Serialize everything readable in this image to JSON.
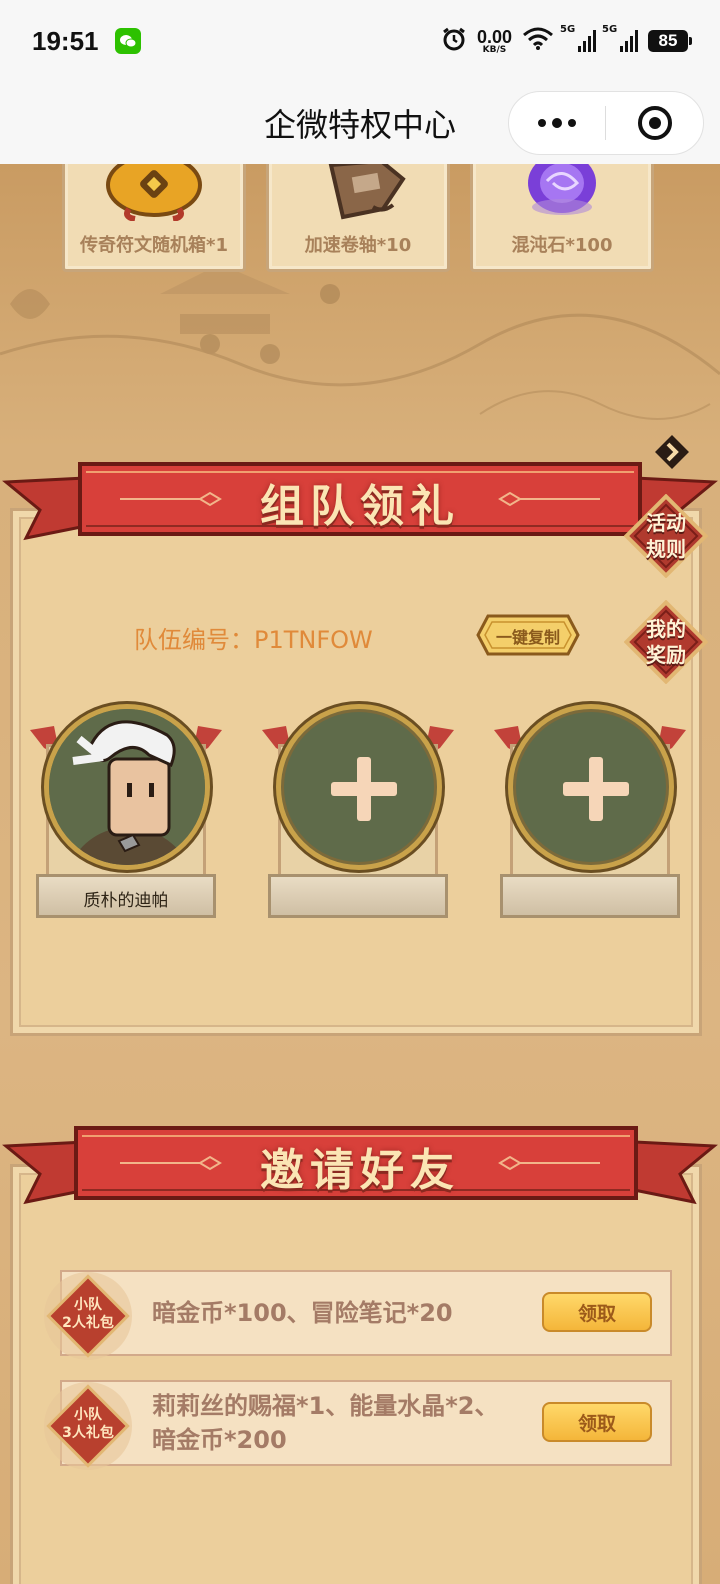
{
  "status_bar": {
    "time": "19:51",
    "net_speed_value": "0.00",
    "net_speed_unit": "KB/S",
    "signal1_label": "5G",
    "signal2_label": "5G",
    "battery": "85"
  },
  "nav": {
    "title": "企微特权中心"
  },
  "top_rewards": [
    {
      "label": "传奇符文随机箱*1",
      "icon": "gold-bag-icon"
    },
    {
      "label": "加速卷轴*10",
      "icon": "scroll-icon"
    },
    {
      "label": "混沌石*100",
      "icon": "purple-orb-icon"
    }
  ],
  "team_section": {
    "title": "组队领礼",
    "rules_label": "活动\n规则",
    "my_rewards_label": "我的\n奖励",
    "team_id_text": "队伍编号：P1TNFOW",
    "copy_label": "一键复制",
    "members": [
      {
        "name": "质朴的迪帕",
        "filled": true
      },
      {
        "name": "",
        "filled": false
      },
      {
        "name": "",
        "filled": false
      }
    ]
  },
  "invite_section": {
    "title": "邀请好友",
    "gifts": [
      {
        "badge": "小队\n2人礼包",
        "desc": "暗金币*100、冒险笔记*20",
        "claim_label": "领取"
      },
      {
        "badge": "小队\n3人礼包",
        "desc": "莉莉丝的赐福*1、能量水晶*2、\n暗金币*200",
        "claim_label": "领取"
      }
    ]
  },
  "colors": {
    "banner_red": "#d8403a",
    "panel_bg": "#eccf9c",
    "team_id_orange": "#e08a3a",
    "claim_yellow": "#f4b63a"
  }
}
